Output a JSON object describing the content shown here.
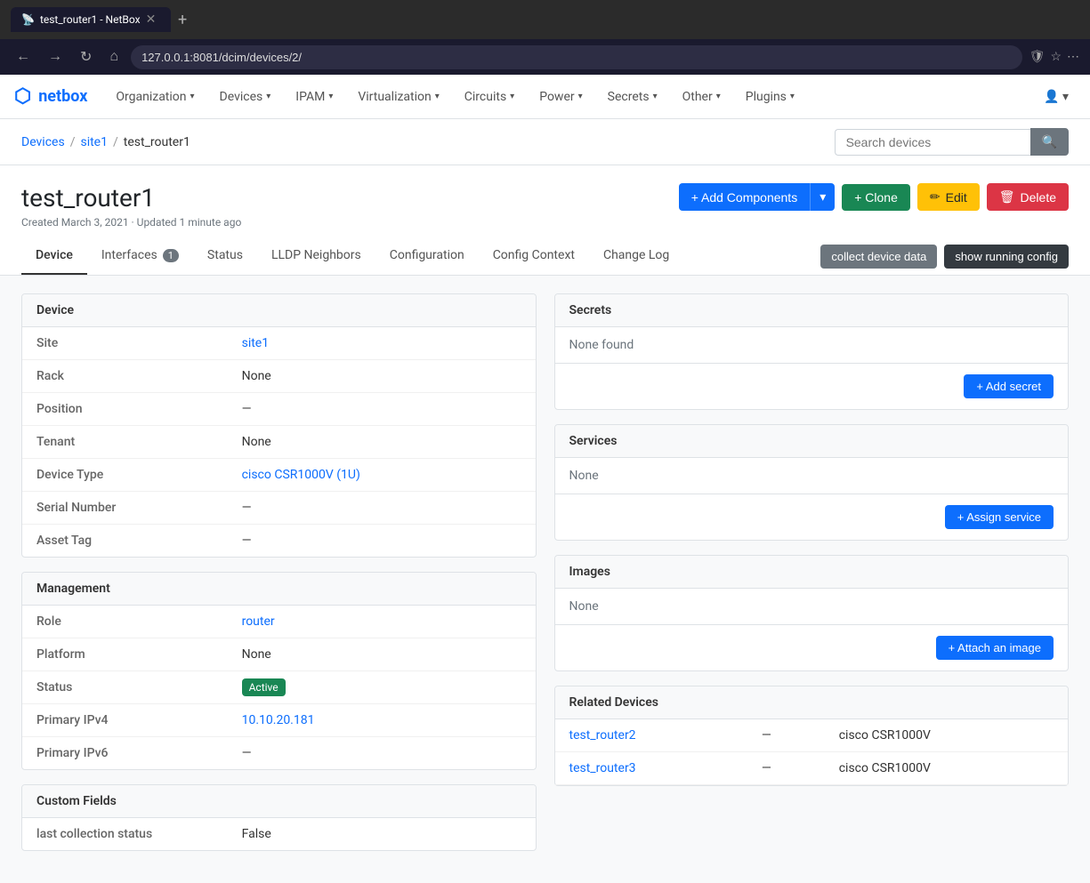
{
  "browser": {
    "tab_title": "test_router1 - NetBox",
    "url": "127.0.0.1:8081/dcim/devices/2/",
    "favicon": "📡"
  },
  "navbar": {
    "brand": "netbox",
    "items": [
      {
        "label": "Organization",
        "has_dropdown": true
      },
      {
        "label": "Devices",
        "has_dropdown": true
      },
      {
        "label": "IPAM",
        "has_dropdown": true
      },
      {
        "label": "Virtualization",
        "has_dropdown": true
      },
      {
        "label": "Circuits",
        "has_dropdown": true
      },
      {
        "label": "Power",
        "has_dropdown": true
      },
      {
        "label": "Secrets",
        "has_dropdown": true
      },
      {
        "label": "Other",
        "has_dropdown": true
      },
      {
        "label": "Plugins",
        "has_dropdown": true
      }
    ]
  },
  "breadcrumb": {
    "items": [
      {
        "label": "Devices",
        "href": "#"
      },
      {
        "label": "site1",
        "href": "#"
      },
      {
        "label": "test_router1",
        "href": "#"
      }
    ]
  },
  "search": {
    "placeholder": "Search devices"
  },
  "page": {
    "title": "test_router1",
    "meta": "Created March 3, 2021 · Updated 1 minute ago"
  },
  "actions": {
    "add_components": "+ Add Components",
    "clone": "+ Clone",
    "edit": "✏ Edit",
    "delete": "🗑 Delete"
  },
  "tabs": [
    {
      "label": "Device",
      "badge": null,
      "active": true
    },
    {
      "label": "Interfaces",
      "badge": "1",
      "active": false
    },
    {
      "label": "Status",
      "badge": null,
      "active": false
    },
    {
      "label": "LLDP Neighbors",
      "badge": null,
      "active": false
    },
    {
      "label": "Configuration",
      "badge": null,
      "active": false
    },
    {
      "label": "Config Context",
      "badge": null,
      "active": false
    },
    {
      "label": "Change Log",
      "badge": null,
      "active": false
    }
  ],
  "tab_actions": {
    "collect": "collect device data",
    "running": "show running config"
  },
  "device_card": {
    "title": "Device",
    "rows": [
      {
        "label": "Site",
        "value": "site1",
        "is_link": true
      },
      {
        "label": "Rack",
        "value": "None",
        "is_link": false
      },
      {
        "label": "Position",
        "value": "—",
        "is_link": false
      },
      {
        "label": "Tenant",
        "value": "None",
        "is_link": false
      },
      {
        "label": "Device Type",
        "value": "cisco CSR1000V (1U)",
        "is_link": true
      },
      {
        "label": "Serial Number",
        "value": "—",
        "is_link": false
      },
      {
        "label": "Asset Tag",
        "value": "—",
        "is_link": false
      }
    ]
  },
  "management_card": {
    "title": "Management",
    "rows": [
      {
        "label": "Role",
        "value": "router",
        "is_link": true
      },
      {
        "label": "Platform",
        "value": "None",
        "is_link": false
      },
      {
        "label": "Status",
        "value": "Active",
        "is_badge": true
      },
      {
        "label": "Primary IPv4",
        "value": "10.10.20.181",
        "is_link": true
      },
      {
        "label": "Primary IPv6",
        "value": "—",
        "is_link": false
      }
    ]
  },
  "custom_fields_card": {
    "title": "Custom Fields",
    "rows": [
      {
        "label": "last collection status",
        "value": "False",
        "is_link": false
      }
    ]
  },
  "secrets_card": {
    "title": "Secrets",
    "none_text": "None found",
    "add_button": "+ Add secret"
  },
  "services_card": {
    "title": "Services",
    "none_text": "None",
    "assign_button": "+ Assign service"
  },
  "images_card": {
    "title": "Images",
    "none_text": "None",
    "attach_button": "+ Attach an image"
  },
  "related_devices_card": {
    "title": "Related Devices",
    "devices": [
      {
        "name": "test_router2",
        "sep": "—",
        "type": "cisco CSR1000V"
      },
      {
        "name": "test_router3",
        "sep": "—",
        "type": "cisco CSR1000V"
      }
    ]
  }
}
